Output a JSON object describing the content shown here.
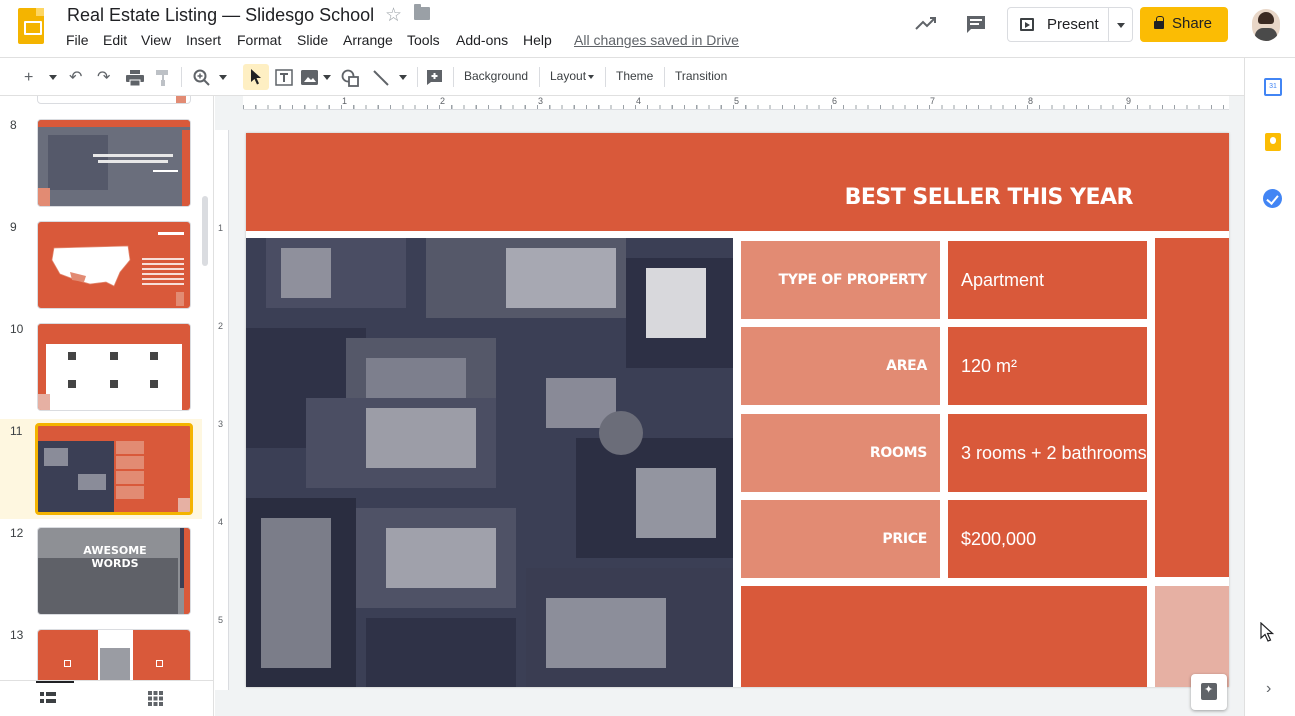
{
  "header": {
    "title": "Real Estate Listing — Slidesgo School",
    "menu": [
      "File",
      "Edit",
      "View",
      "Insert",
      "Format",
      "Slide",
      "Arrange",
      "Tools",
      "Add-ons",
      "Help"
    ],
    "save_status": "All changes saved in Drive",
    "present_label": "Present",
    "share_label": "Share"
  },
  "toolbar": {
    "background_label": "Background",
    "layout_label": "Layout",
    "theme_label": "Theme",
    "transition_label": "Transition"
  },
  "filmstrip": {
    "slide_numbers": [
      "8",
      "9",
      "10",
      "11",
      "12",
      "13"
    ],
    "active_slide": "11",
    "thumb12_text": "AWESOME WORDS"
  },
  "ruler": {
    "h_marks": [
      "1",
      "1",
      "2",
      "3",
      "4",
      "5",
      "6",
      "7",
      "8",
      "9"
    ],
    "v_marks": [
      "1",
      "2",
      "3",
      "4",
      "5"
    ]
  },
  "slide": {
    "title": "BEST SELLER THIS YEAR",
    "rows": [
      {
        "label": "TYPE OF PROPERTY",
        "value": "Apartment"
      },
      {
        "label": "AREA",
        "value": "120 m²"
      },
      {
        "label": "ROOMS",
        "value": "3 rooms + 2 bathrooms"
      },
      {
        "label": "PRICE",
        "value": "$200,000"
      }
    ]
  },
  "side_panel": {
    "calendar_day": "31"
  },
  "colors": {
    "accent_orange": "#d9593a",
    "label_salmon": "#e28b73",
    "light_pink": "#e6b0a3",
    "share_yellow": "#fbbc04"
  }
}
